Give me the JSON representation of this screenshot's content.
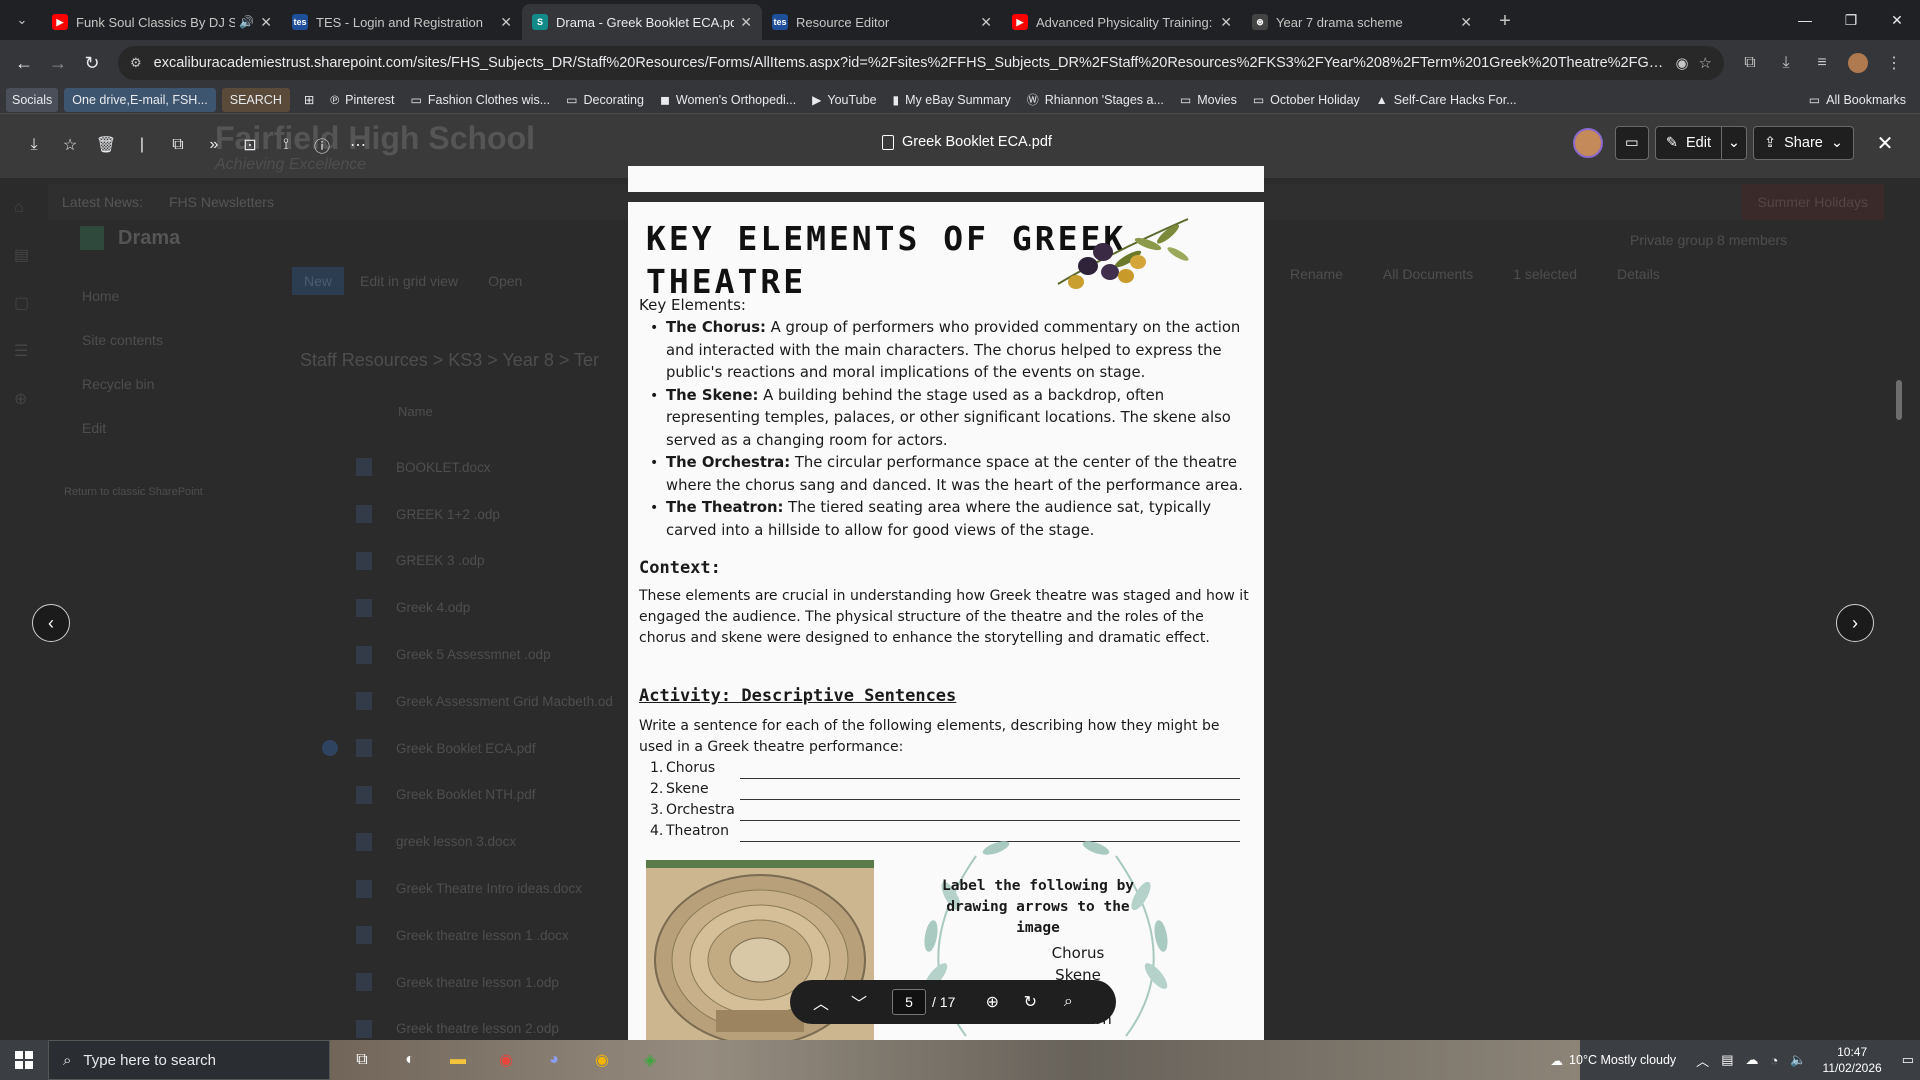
{
  "browser": {
    "tabs": [
      {
        "title": "Funk Soul Classics By DJ Sm",
        "favicon": "youtube-icon",
        "color": "#ff0000",
        "glyph": "▶",
        "audio": true
      },
      {
        "title": "TES - Login and Registration",
        "favicon": "tes-icon",
        "color": "#1f4e9b",
        "glyph": "tes"
      },
      {
        "title": "Drama - Greek Booklet ECA.pdf",
        "favicon": "sharepoint-icon",
        "color": "#138a8a",
        "glyph": "S",
        "active": true
      },
      {
        "title": "Resource Editor",
        "favicon": "tes-icon",
        "color": "#1f4e9b",
        "glyph": "tes"
      },
      {
        "title": "Advanced Physicality Training: C",
        "favicon": "youtube-icon",
        "color": "#ff0000",
        "glyph": "▶"
      },
      {
        "title": "Year 7 drama scheme",
        "favicon": "openai-icon",
        "color": "#444",
        "glyph": "⊛"
      }
    ],
    "url": "excaliburacademiestrust.sharepoint.com/sites/FHS_Subjects_DR/Staff%20Resources/Forms/AllItems.aspx?id=%2Fsites%2FFHS_Subjects_DR%2FStaff%20Resources%2FKS3%2FYear%208%2FTerm%201Greek%20Theatre%2FGreek%20Booklet...",
    "bookmarks": [
      {
        "label": "Socials",
        "kind": "tag"
      },
      {
        "label": "One drive,E-mail, FSH...",
        "kind": "tag2"
      },
      {
        "label": "SEARCH",
        "kind": "tag3"
      },
      {
        "label": "Pinterest",
        "icon": "pinterest-icon",
        "glyph": "℗"
      },
      {
        "label": "Fashion Clothes wis...",
        "icon": "folder-icon",
        "glyph": "▭"
      },
      {
        "label": "Decorating",
        "icon": "folder-icon",
        "glyph": "▭"
      },
      {
        "label": "Women's Orthopedi...",
        "icon": "site-icon",
        "glyph": "◼"
      },
      {
        "label": "YouTube",
        "icon": "youtube-icon",
        "glyph": "▶"
      },
      {
        "label": "My eBay Summary",
        "icon": "ebay-icon",
        "glyph": "▮"
      },
      {
        "label": "Rhiannon 'Stages a...",
        "icon": "wordpress-icon",
        "glyph": "Ⓦ"
      },
      {
        "label": "Movies",
        "icon": "folder-icon",
        "glyph": "▭"
      },
      {
        "label": "October Holiday",
        "icon": "folder-icon",
        "glyph": "▭"
      },
      {
        "label": "Self-Care Hacks For...",
        "icon": "drive-icon",
        "glyph": "▲"
      }
    ],
    "all_bookmarks": "All Bookmarks"
  },
  "background_site": {
    "school_name": "Fairfield High School",
    "tagline": "Achieving Excellence",
    "news": [
      "Latest News:",
      "FHS Newsletters"
    ],
    "summer": "Summer Holidays",
    "site": "Drama",
    "private": "Private group    8 members",
    "nav": [
      "Home",
      "Site contents",
      "Recycle bin",
      "Edit"
    ],
    "return": "Return to classic SharePoint",
    "cmd": [
      "New",
      "Edit in grid view",
      "Open"
    ],
    "cmd_right": [
      "Rename",
      "All Documents",
      "1 selected",
      "Details"
    ],
    "breadcrumb": "Staff Resources  >  KS3  >  Year 8  >  Ter",
    "name_header": "Name",
    "files": [
      "BOOKLET.docx",
      "GREEK 1+2 .odp",
      "GREEK 3 .odp",
      "Greek 4.odp",
      "Greek 5 Assessmnet .odp",
      "Greek Assessment Grid Macbeth.od",
      "Greek Booklet ECA.pdf",
      "Greek Booklet NTH.pdf",
      "greek lesson 3.docx",
      "Greek Theatre Intro ideas.docx",
      "Greek theatre lesson 1 .docx",
      "Greek theatre lesson 1.odp",
      "Greek theatre lesson 2.odp"
    ]
  },
  "viewer": {
    "filename": "Greek Booklet ECA.pdf",
    "edit_label": "Edit",
    "share_label": "Share",
    "page_current": "5",
    "page_total": "/ 17"
  },
  "document": {
    "title_line1": "KEY ELEMENTS OF GREEK",
    "title_line2": "THEATRE",
    "key_label": "Key Elements:",
    "elements": [
      {
        "term": "The Chorus:",
        "text": " A group of performers who provided commentary on the action and interacted with the main characters. The chorus helped to express the public's reactions and moral implications of the events on stage."
      },
      {
        "term": "The Skene:",
        "text": " A building behind the stage used as a backdrop, often representing temples, palaces, or other significant locations. The skene also served as a changing room for actors."
      },
      {
        "term": "The Orchestra:",
        "text": " The circular performance space at the center of the theatre where the chorus sang and danced. It was the heart of the performance area."
      },
      {
        "term": "The Theatron:",
        "text": " The tiered seating area where the audience sat, typically carved into a hillside to allow for good views of the stage."
      }
    ],
    "context_heading": "Context:",
    "context_text": "These elements are crucial in understanding how Greek theatre was staged and how it engaged the audience. The physical structure of the theatre and the roles of the chorus and skene were designed to enhance the storytelling and dramatic effect.",
    "activity_heading": "Activity: Descriptive Sentences",
    "activity_text": "Write a sentence for each of the following elements, describing how they might be used in a Greek theatre performance:",
    "activity_items": [
      {
        "n": "1.",
        "label": "Chorus"
      },
      {
        "n": "2.",
        "label": "Skene"
      },
      {
        "n": "3.",
        "label": "Orchestra"
      },
      {
        "n": "4.",
        "label": "Theatron"
      }
    ],
    "label_heading": "Label the following by drawing arrows to the image",
    "label_words": [
      "Chorus",
      "Skene",
      "",
      "Theatron"
    ]
  },
  "taskbar": {
    "search_placeholder": "Type here to search",
    "weather": "10°C  Mostly cloudy",
    "time": "10:47",
    "date": "11/02/2026"
  }
}
